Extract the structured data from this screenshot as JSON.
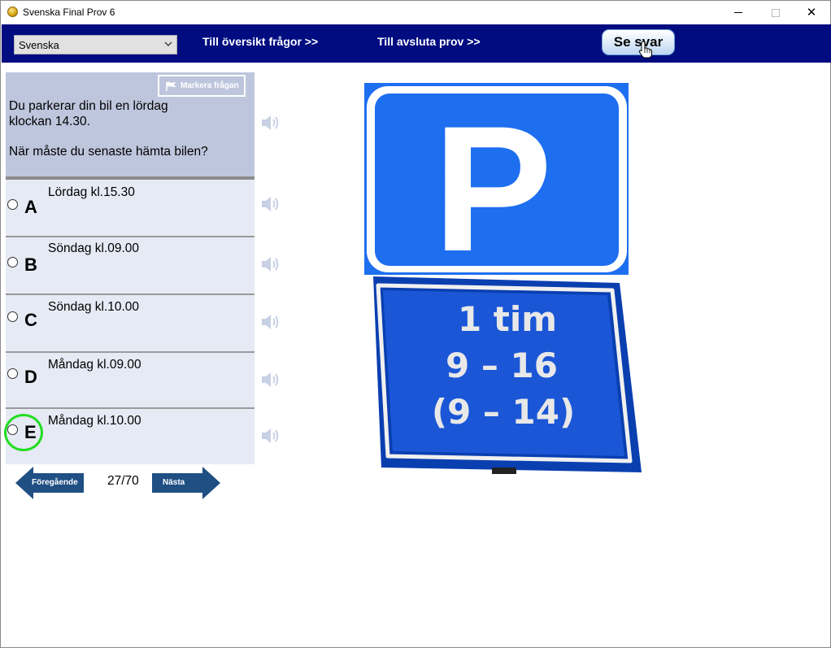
{
  "window": {
    "title": "Svenska Final Prov 6",
    "close_glyph": "✕"
  },
  "topbar": {
    "language": "Svenska",
    "overview_link": "Till översikt frågor >>",
    "finish_link": "Till avsluta prov  >>",
    "show_answer": "Se svar",
    "background": "#000c80"
  },
  "question": {
    "mark_label": "Markera frågan",
    "line1": "Du parkerar din bil en lördag klockan 14.30.",
    "line2": "När måste du senaste hämta bilen?"
  },
  "options": [
    {
      "letter": "A",
      "text": "Lördag kl.15.30"
    },
    {
      "letter": "B",
      "text": "Söndag kl.09.00"
    },
    {
      "letter": "C",
      "text": "Söndag kl.10.00"
    },
    {
      "letter": "D",
      "text": "Måndag kl.09.00"
    },
    {
      "letter": "E",
      "text": "Måndag kl.10.00"
    }
  ],
  "highlighted_option": "E",
  "pager": {
    "prev_label": "Föregående",
    "next_label": "Nästa",
    "current": "27/70"
  },
  "signs": {
    "parking_letter": "P",
    "supplementary": [
      "1 tim",
      "9 – 16",
      "(9 – 14)"
    ],
    "sign_blue": "#1e6ef0"
  }
}
